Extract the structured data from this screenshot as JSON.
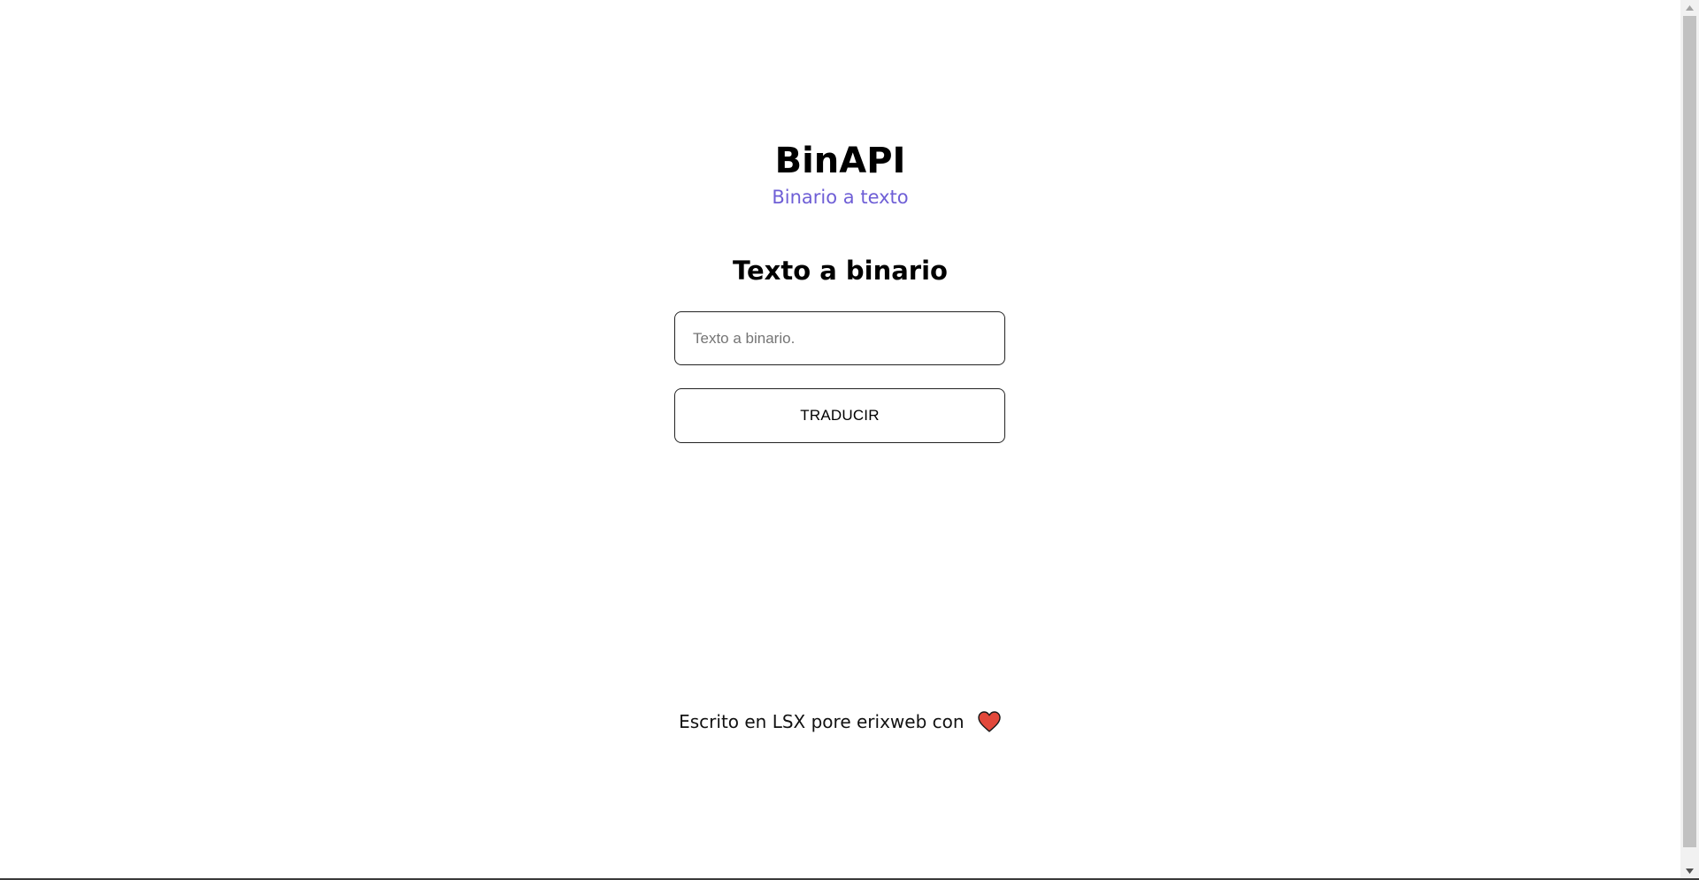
{
  "header": {
    "title": "BinAPI",
    "mode_link": "Binario a texto"
  },
  "main": {
    "section_title": "Texto a binario",
    "input_placeholder": "Texto a binario.",
    "input_value": "",
    "button_label": "TRADUCIR"
  },
  "footer": {
    "text": "Escrito en LSX pore erixweb con",
    "icon": "heart-icon"
  },
  "colors": {
    "link": "#6f5fd6",
    "heart": "#e2483b",
    "text": "#000000"
  }
}
